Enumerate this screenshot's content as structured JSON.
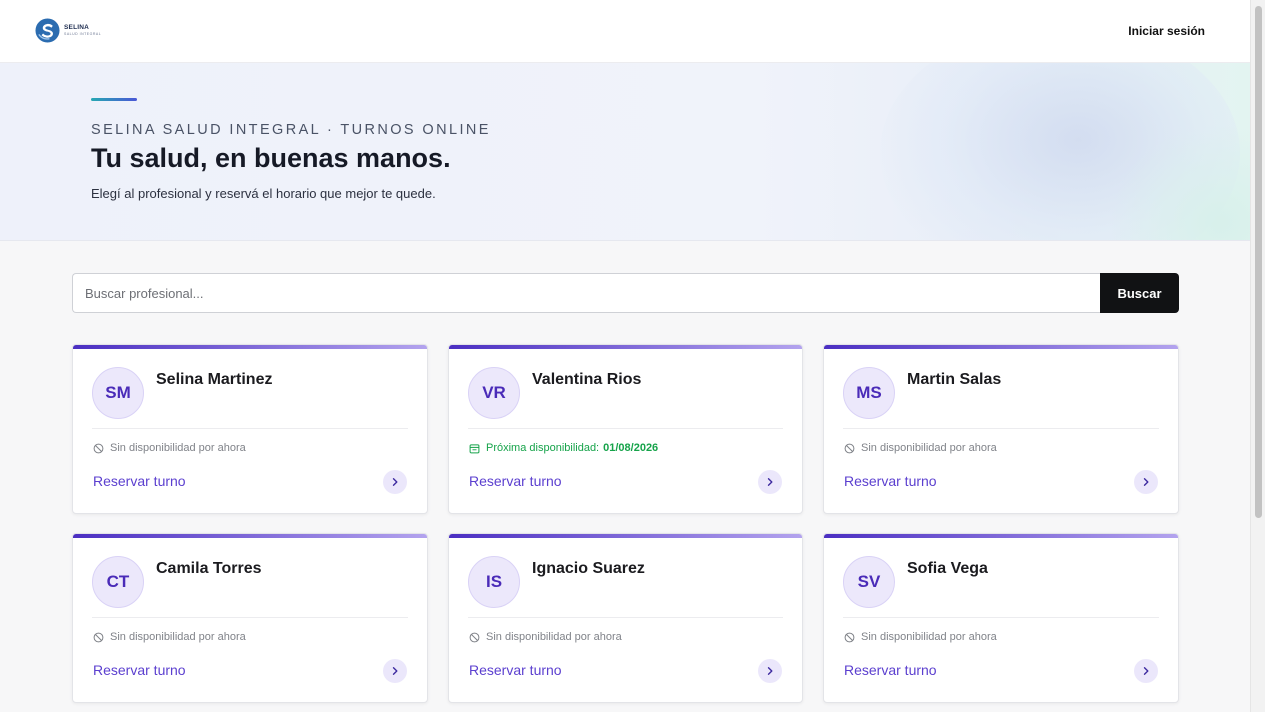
{
  "brand": {
    "name": "SELINA",
    "tagline": "SALUD INTEGRAL"
  },
  "header": {
    "login_label": "Iniciar sesión"
  },
  "hero": {
    "eyebrow": "SELINA SALUD INTEGRAL · TURNOS ONLINE",
    "title": "Tu salud, en buenas manos.",
    "subtitle": "Elegí al profesional y reservá el horario que mejor te quede."
  },
  "search": {
    "placeholder": "Buscar profesional...",
    "button_label": "Buscar"
  },
  "professionals": [
    {
      "initials": "SM",
      "name": "Selina Martinez",
      "status": "Sin disponibilidad por ahora",
      "next_date": "",
      "action": "Reservar turno"
    },
    {
      "initials": "VR",
      "name": "Valentina Rios",
      "status": "Próxima disponibilidad:",
      "next_date": "01/08/2026",
      "action": "Reservar turno"
    },
    {
      "initials": "MS",
      "name": "Martin Salas",
      "status": "Sin disponibilidad por ahora",
      "next_date": "",
      "action": "Reservar turno"
    },
    {
      "initials": "CT",
      "name": "Camila Torres",
      "status": "Sin disponibilidad por ahora",
      "next_date": "",
      "action": "Reservar turno"
    },
    {
      "initials": "IS",
      "name": "Ignacio Suarez",
      "status": "Sin disponibilidad por ahora",
      "next_date": "",
      "action": "Reservar turno"
    },
    {
      "initials": "SV",
      "name": "Sofia Vega",
      "status": "Sin disponibilidad por ahora",
      "next_date": "",
      "action": "Reservar turno"
    }
  ],
  "colors": {
    "accent": "#5b3fcf",
    "available": "#16a34a",
    "unavailable": "#808389",
    "button_dark": "#111214"
  },
  "icons": {
    "unavailable": "ban-icon",
    "available": "calendar-icon",
    "action": "chevron-right-icon"
  }
}
